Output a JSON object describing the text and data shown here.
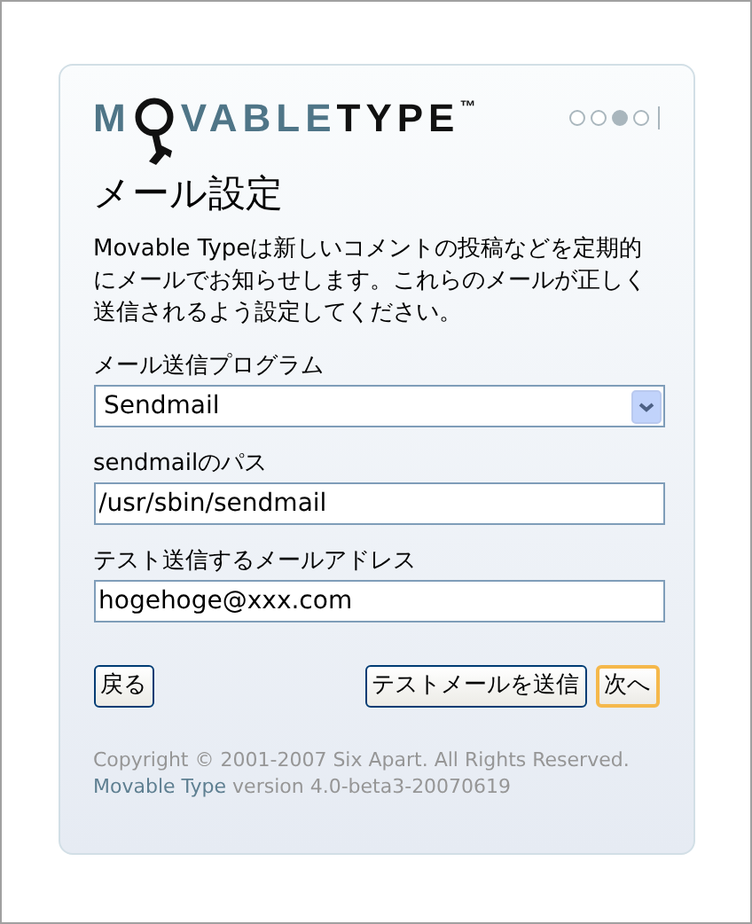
{
  "logo": {
    "first": "M",
    "middle": "VABLE",
    "last": "TYPE",
    "mark": "™"
  },
  "steps": [
    {
      "selected": false
    },
    {
      "selected": false
    },
    {
      "selected": true
    },
    {
      "selected": false
    }
  ],
  "title": "メール設定",
  "intro": "Movable Typeは新しいコメントの投稿などを定期的にメールでお知らせします。これらのメールが正しく送信されるよう設定してください。",
  "fields": [
    {
      "kind": "select",
      "label": "メール送信プログラム",
      "value": "Sendmail"
    },
    {
      "kind": "text",
      "label": "sendmailのパス",
      "value": "/usr/sbin/sendmail"
    },
    {
      "kind": "text",
      "label": "テスト送信するメールアドレス",
      "value": "hogehoge@xxx.com"
    }
  ],
  "buttons": [
    {
      "label": "戻る",
      "focused": false
    },
    {
      "label": "テストメールを送信",
      "focused": false
    },
    {
      "label": "次へ",
      "focused": true
    }
  ],
  "footer": {
    "copyright": "Copyright © 2001-2007 Six Apart. All Rights Reserved.",
    "product_link": "Movable Type",
    "version": " version 4.0-beta3-20070619"
  }
}
